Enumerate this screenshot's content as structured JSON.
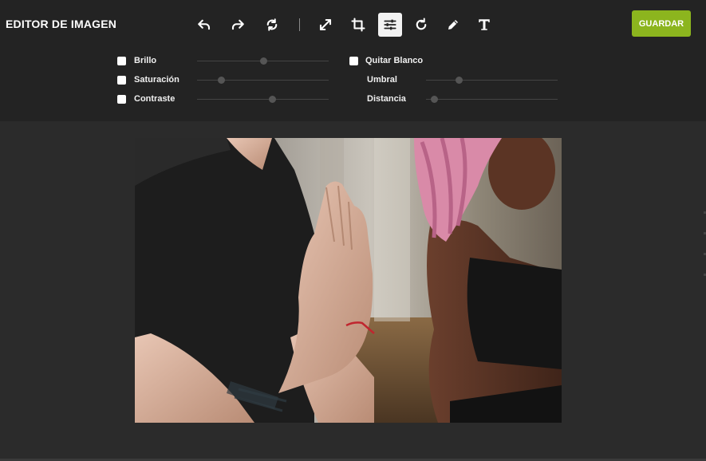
{
  "app": {
    "title": "EDITOR DE IMAGEN",
    "save_label": "GUARDAR",
    "accent": "#8cb51e"
  },
  "toolbar": {
    "tools": [
      {
        "name": "undo-icon",
        "active": false
      },
      {
        "name": "redo-icon",
        "active": false
      },
      {
        "name": "reset-icon",
        "active": false
      },
      {
        "name": "resize-icon",
        "active": false
      },
      {
        "name": "crop-icon",
        "active": false
      },
      {
        "name": "adjust-icon",
        "active": true
      },
      {
        "name": "rotate-icon",
        "active": false
      },
      {
        "name": "pencil-icon",
        "active": false
      },
      {
        "name": "text-icon",
        "active": false
      }
    ]
  },
  "filters": {
    "left": [
      {
        "label": "Brillo",
        "checked": false,
        "value": 0.5
      },
      {
        "label": "Saturación",
        "checked": false,
        "value": 0.18
      },
      {
        "label": "Contraste",
        "checked": false,
        "value": 0.57
      }
    ],
    "right": {
      "remove_white": {
        "label": "Quitar Blanco",
        "checked": false
      },
      "threshold": {
        "label": "Umbral",
        "value": 0.25
      },
      "distance": {
        "label": "Distancia",
        "value": 0.06
      }
    }
  }
}
